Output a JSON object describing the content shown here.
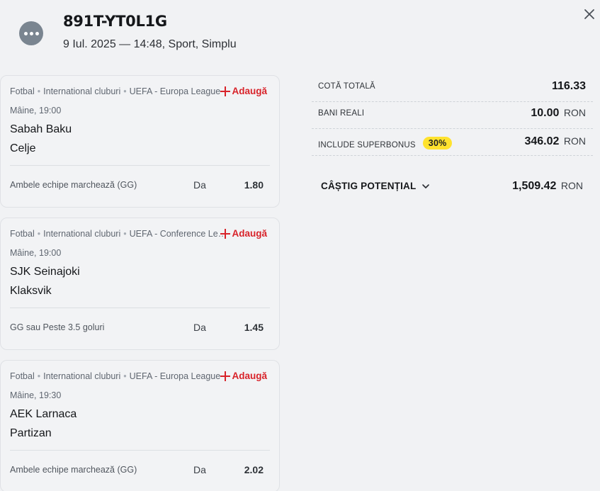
{
  "header": {
    "ticket_id": "891T-YT0L1G",
    "meta": "9 Iul. 2025 — 14:48, Sport, Simplu",
    "more_icon": "more-horizontal-icon",
    "close_icon": "close-icon"
  },
  "events": [
    {
      "sport": "Fotbal",
      "country": "International cluburi",
      "league": "UEFA - Europa League",
      "add_label": "Adaugă",
      "time": "Mâine, 19:00",
      "home": "Sabah Baku",
      "away": "Celje",
      "market": "Ambele echipe marchează (GG)",
      "pick": "Da",
      "odd": "1.80"
    },
    {
      "sport": "Fotbal",
      "country": "International cluburi",
      "league": "UEFA - Conference Le…",
      "add_label": "Adaugă",
      "time": "Mâine, 19:00",
      "home": "SJK Seinajoki",
      "away": "Klaksvik",
      "market": "GG sau Peste 3.5 goluri",
      "pick": "Da",
      "odd": "1.45"
    },
    {
      "sport": "Fotbal",
      "country": "International cluburi",
      "league": "UEFA - Europa League",
      "add_label": "Adaugă",
      "time": "Mâine, 19:30",
      "home": "AEK Larnaca",
      "away": "Partizan",
      "market": "Ambele echipe marchează (GG)",
      "pick": "Da",
      "odd": "2.02"
    }
  ],
  "summary": {
    "total_odds_label": "COTĂ TOTALĂ",
    "total_odds_value": "116.33",
    "real_money_label": "BANI REALI",
    "real_money_value": "10.00",
    "superbonus_label": "INCLUDE SUPERBONUS",
    "superbonus_badge": "30%",
    "superbonus_value": "346.02",
    "currency": "RON",
    "potential_label": "CÂȘTIG POTENȚIAL",
    "potential_value": "1,509.42",
    "badge_color": "#ffe22e",
    "accent_color": "#d8232a"
  }
}
